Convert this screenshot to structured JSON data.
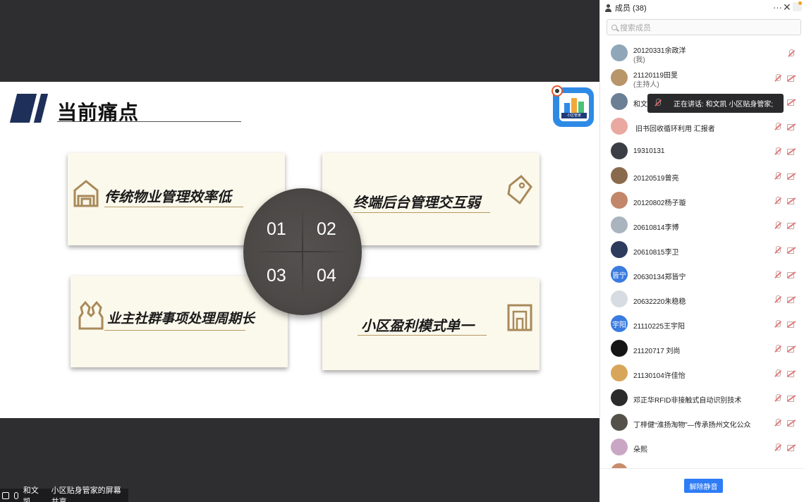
{
  "slide": {
    "title": "当前痛点",
    "logo_label": "小区管家",
    "cards": [
      {
        "text": "传统物业管理效率低",
        "icon": "house-icon"
      },
      {
        "text": "终端后台管理交互弱",
        "icon": "tag-icon"
      },
      {
        "text": "业主社群事项处理周期长",
        "icon": "people-icon"
      },
      {
        "text": "小区盈利模式单一",
        "icon": "building-icon"
      }
    ],
    "numbers": [
      "01",
      "02",
      "03",
      "04"
    ]
  },
  "share_bar": {
    "presenter": "和文凯",
    "text": "小区贴身管家的屏幕共享"
  },
  "panel": {
    "title": "成员 (38)",
    "more_label": "···",
    "close_label": "✕",
    "search_placeholder": "搜索成员",
    "tooltip": "正在讲话: 和文凯  小区贴身管家;",
    "members": [
      {
        "name": "20120331余政洋",
        "sub": "(我)",
        "avatar_color": "#8fa7b8",
        "avatar_text": ""
      },
      {
        "name": "21120119田旻",
        "sub": "(主持人)",
        "avatar_color": "#b9956a",
        "avatar_text": ""
      },
      {
        "name": "和文",
        "sub": "",
        "avatar_color": "#6b7f95",
        "avatar_text": ""
      },
      {
        "name": "旧书回收循环利用 汇报者",
        "sub": "",
        "avatar_color": "#e9a9a0",
        "avatar_text": ""
      },
      {
        "name": "19310131",
        "sub": "",
        "avatar_color": "#3b3f45",
        "avatar_text": ""
      },
      {
        "name": "20120519曾亮",
        "sub": "",
        "avatar_color": "#8a6a4c",
        "avatar_text": ""
      },
      {
        "name": "20120802杨子璇",
        "sub": "",
        "avatar_color": "#c2866a",
        "avatar_text": ""
      },
      {
        "name": "20610814李博",
        "sub": "",
        "avatar_color": "#aab4bf",
        "avatar_text": ""
      },
      {
        "name": "20610815李卫",
        "sub": "",
        "avatar_color": "#2d3b5c",
        "avatar_text": ""
      },
      {
        "name": "20630134郑皆宁",
        "sub": "",
        "avatar_color": "#3a7be0",
        "avatar_text": "皆宁"
      },
      {
        "name": "20632220朱稳稳",
        "sub": "",
        "avatar_color": "#d7dbe2",
        "avatar_text": ""
      },
      {
        "name": "21110225王宇阳",
        "sub": "",
        "avatar_color": "#3a7be0",
        "avatar_text": "宇阳"
      },
      {
        "name": "21120717 刘尚",
        "sub": "",
        "avatar_color": "#151515",
        "avatar_text": ""
      },
      {
        "name": "21130104许佳怡",
        "sub": "",
        "avatar_color": "#d8a65a",
        "avatar_text": ""
      },
      {
        "name": "邓正华RFID非接触式自动识别技术",
        "sub": "",
        "avatar_color": "#2c2c2c",
        "avatar_text": ""
      },
      {
        "name": "丁梓健“淮扬淘物”—传承扬州文化公众",
        "sub": "",
        "avatar_color": "#54514a",
        "avatar_text": ""
      },
      {
        "name": "朵熙",
        "sub": "",
        "avatar_color": "#c9a7c4",
        "avatar_text": ""
      },
      {
        "name": "",
        "sub": "",
        "avatar_color": "#c98c6a",
        "avatar_text": ""
      }
    ],
    "unmute_label": "解除静音"
  }
}
